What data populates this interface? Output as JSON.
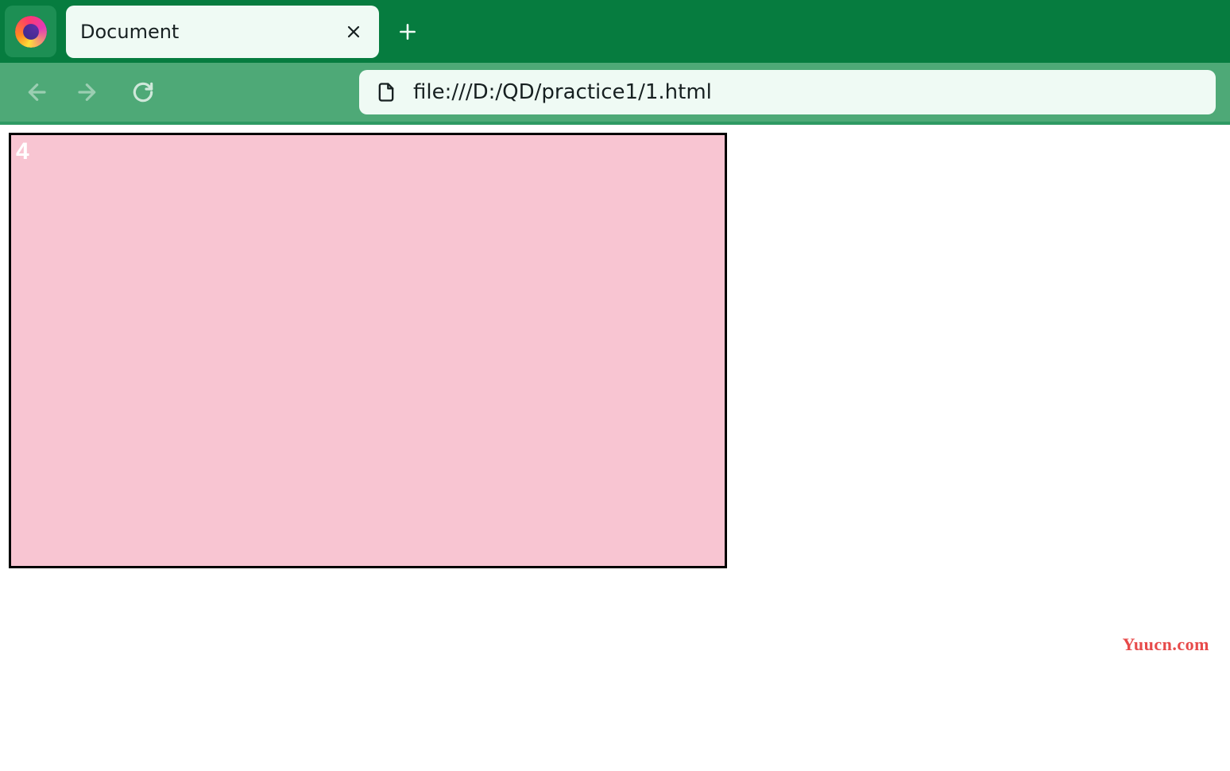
{
  "browser": {
    "tab_title": "Document",
    "url": "file:///D:/QD/practice1/1.html"
  },
  "content": {
    "box_label": "4"
  },
  "watermark": "Yuucn.com"
}
